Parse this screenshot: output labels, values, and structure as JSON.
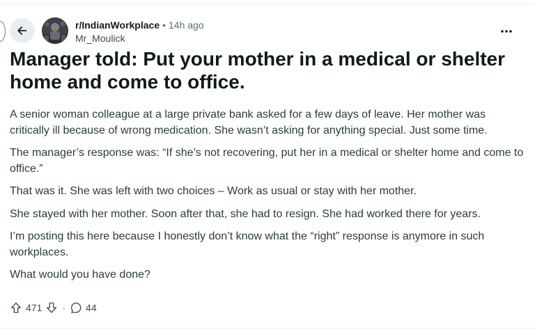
{
  "post": {
    "subreddit": "r/IndianWorkplace",
    "separator": "•",
    "time_ago": "14h ago",
    "author": "Mr_Moulick",
    "title": "Manager told: Put your mother in a medical or shelter home and come to office.",
    "paragraphs": [
      "A senior woman colleague at a large private bank asked for a few days of leave. Her mother was critically ill because of wrong medication. She wasn’t asking for anything special. Just some time.",
      "The manager’s response was: “If she’s not recovering, put her in a medical or shelter home and come to office.”",
      "That was it. She was left with two choices – Work as usual or stay with her mother.",
      "She stayed with her mother. Soon after that, she had to resign. She had worked there for years.",
      "I’m posting this here because I honestly don’t know what the “right” response is anymore in such workplaces.",
      "What would you have done?"
    ],
    "votes": "471",
    "action_separator": "·",
    "comments": "44"
  },
  "icons": {
    "back": "arrow-left-icon",
    "more": "ellipsis-icon",
    "upvote": "arrow-up-icon",
    "downvote": "arrow-down-icon",
    "comment": "comment-bubble-icon"
  },
  "colors": {
    "button_bg": "#eaedef",
    "meta_text": "#576f76",
    "title_text": "#0f1a1c"
  }
}
